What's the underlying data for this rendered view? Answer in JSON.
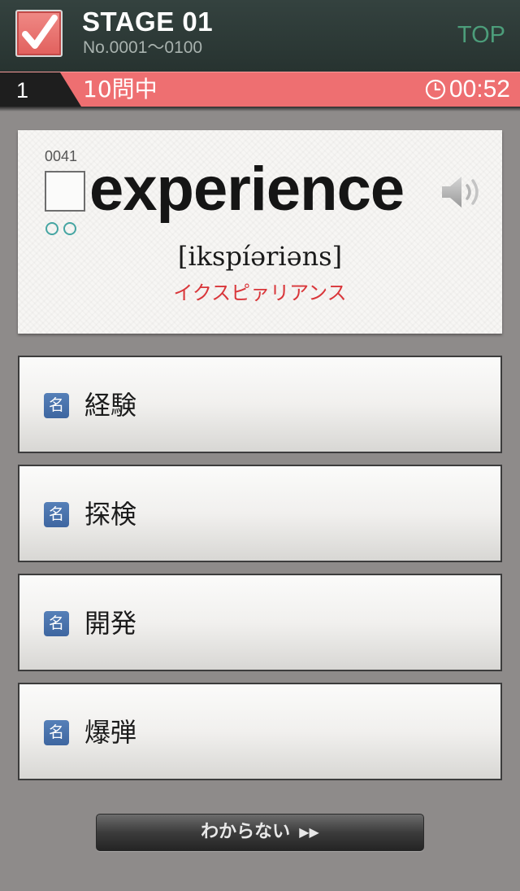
{
  "header": {
    "stage_title": "STAGE 01",
    "stage_range": "No.0001～0100",
    "top_label": "TOP"
  },
  "progress": {
    "question_number": "1",
    "count_label": "10問中",
    "timer": "00:52"
  },
  "word_card": {
    "number": "0041",
    "word": "experience",
    "phonetic": "[ikspíəriəns]",
    "katakana": "イクスピァリアンス",
    "mastery_dots": 2
  },
  "choices": [
    {
      "pos": "名",
      "label": "経験"
    },
    {
      "pos": "名",
      "label": "探検"
    },
    {
      "pos": "名",
      "label": "開発"
    },
    {
      "pos": "名",
      "label": "爆弾"
    }
  ],
  "skip_button": {
    "label": "わからない",
    "arrows": "▶▶"
  },
  "colors": {
    "header_bg": "#2c3936",
    "progress_bg": "#ee6f71",
    "top_link": "#4c9d7a",
    "katakana": "#d9363a",
    "pos_badge": "#4a72ab",
    "dot": "#45a5a2"
  }
}
